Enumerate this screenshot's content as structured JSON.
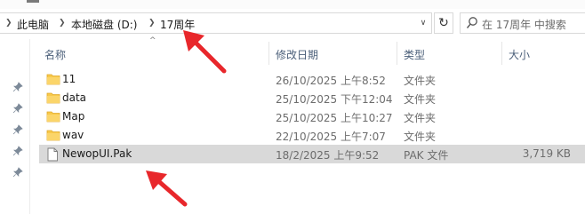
{
  "address_bar": {
    "breadcrumbs": [
      "此电脑",
      "本地磁盘 (D:)",
      "17周年"
    ]
  },
  "search": {
    "placeholder": "在 17周年 中搜索"
  },
  "columns": {
    "name": "名称",
    "modified": "修改日期",
    "type": "类型",
    "size": "大小"
  },
  "files": [
    {
      "name": "11",
      "modified": "26/10/2025 上午8:52",
      "type": "文件夹",
      "size": "",
      "icon": "folder-icon"
    },
    {
      "name": "data",
      "modified": "25/10/2025 下午12:04",
      "type": "文件夹",
      "size": "",
      "icon": "folder-icon"
    },
    {
      "name": "Map",
      "modified": "25/10/2025 上午10:27",
      "type": "文件夹",
      "size": "",
      "icon": "folder-icon"
    },
    {
      "name": "wav",
      "modified": "22/10/2025 上午7:07",
      "type": "文件夹",
      "size": "",
      "icon": "folder-icon"
    },
    {
      "name": "NewopUI.Pak",
      "modified": "18/2/2025 上午9:52",
      "type": "PAK 文件",
      "size": "3,719 KB",
      "icon": "file-icon",
      "selected": true
    }
  ],
  "colors": {
    "annotation_arrow": "#e8272b",
    "folder": "#f8c94a",
    "selection": "#d9d9d9"
  }
}
